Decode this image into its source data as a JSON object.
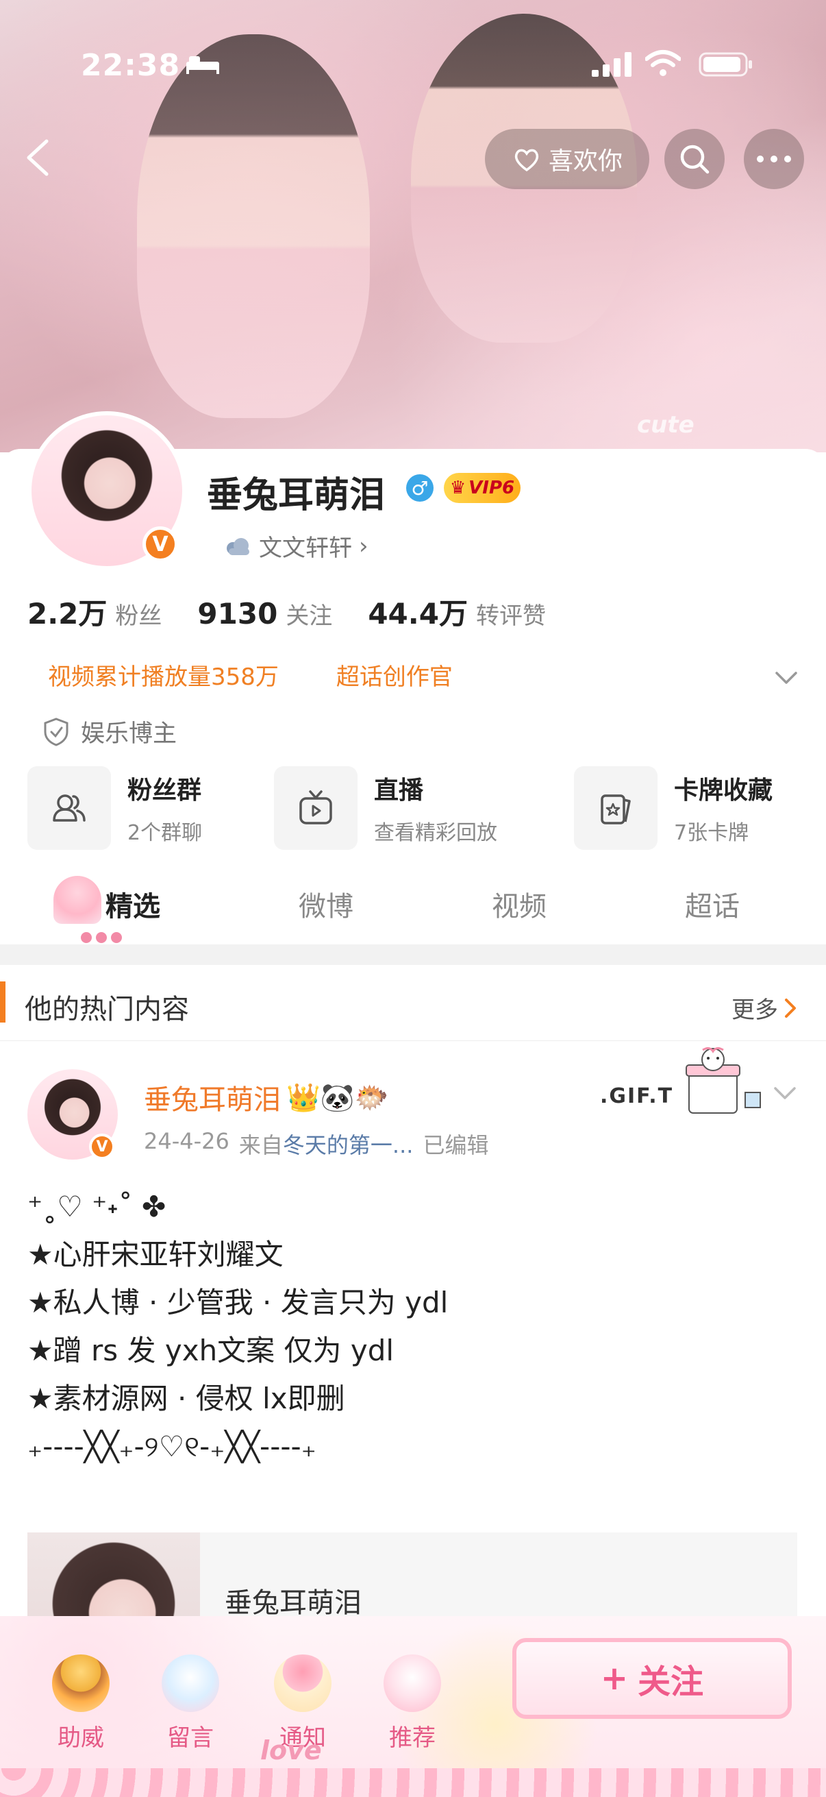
{
  "status_bar": {
    "time": "22:38"
  },
  "header": {
    "like_label": "喜欢你",
    "banner_texts": {
      "cute": "cute"
    }
  },
  "profile": {
    "username": "垂兔耳萌泪",
    "gender_symbol": "♂",
    "vip_label": "VIP6",
    "verified_mark": "V",
    "sub_label": "文文轩轩",
    "stats": [
      {
        "value": "2.2万",
        "label": "粉丝"
      },
      {
        "value": "9130",
        "label": "关注"
      },
      {
        "value": "44.4万",
        "label": "转评赞"
      }
    ],
    "tags": [
      "视频累计播放量358万",
      "超话创作官"
    ],
    "certification": "娱乐博主",
    "entries": [
      {
        "title": "粉丝群",
        "subtitle": "2个群聊",
        "icon": "group-icon"
      },
      {
        "title": "直播",
        "subtitle": "查看精彩回放",
        "icon": "tv-icon"
      },
      {
        "title": "卡牌收藏",
        "subtitle": "7张卡牌",
        "icon": "card-icon"
      }
    ],
    "tabs": [
      "精选",
      "微博",
      "视频",
      "超话"
    ],
    "active_tab": "精选"
  },
  "hot": {
    "title": "他的热门内容",
    "more_label": "更多",
    "post": {
      "author": "垂兔耳萌泪",
      "author_emojis": "👑🐼🐡",
      "date": "24-4-26",
      "from_prefix": "来自",
      "source": "冬天的第一...",
      "edited": "已编辑",
      "gift_deco": ".GIF.T",
      "lines": [
        "⁺˳♡ ⁺˖˚ ✤",
        "★心肝宋亚轩刘耀文",
        "★私人博 · 少管我 · 发言只为 ydl",
        "★蹭 rs 发 yxh文案 仅为 ydl",
        "★素材源网 · 侵权 lx即删",
        "₊----╳╳₊-୨♡୧-₊╳╳----₊"
      ],
      "repost_name": "垂兔耳萌泪"
    }
  },
  "bottom_bar": {
    "items": [
      "助威",
      "留言",
      "通知",
      "推荐"
    ],
    "follow_label": "关注",
    "follow_plus": "+",
    "deco_text": "love"
  },
  "colors": {
    "accent_orange": "#f47f20",
    "pink": "#ef5a8a",
    "link_blue": "#5b7ca8"
  }
}
